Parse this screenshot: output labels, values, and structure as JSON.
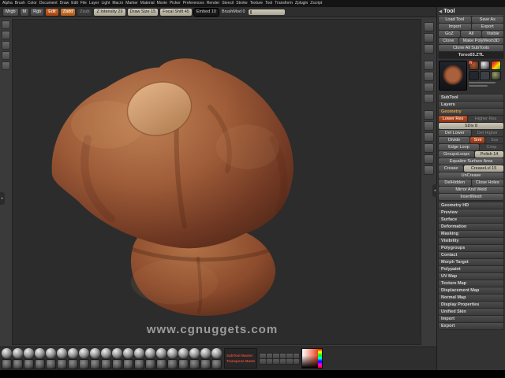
{
  "menu": {
    "items": [
      "Alpha",
      "Brush",
      "Color",
      "Document",
      "Draw",
      "Edit",
      "File",
      "Layer",
      "Light",
      "Macro",
      "Marker",
      "Material",
      "Movie",
      "Picker",
      "Preferences",
      "Render",
      "Stencil",
      "Stroke",
      "Texture",
      "Tool",
      "Transform",
      "Zplugin",
      "Zscript"
    ]
  },
  "shelf": {
    "mrgb": "Mrgb",
    "m": "M",
    "rgb": "Rgb",
    "edit": "Edit",
    "zadd": "Zadd",
    "zsub": "Zsub",
    "z_intensity": "Z Intensity 29",
    "draw_size": "Draw Size 15",
    "focal_shift": "Focal Shift 45",
    "embed": "Embed 10",
    "brush_mod": "BrushMod 0"
  },
  "canvas": {
    "watermark": "www.cgnuggets.com"
  },
  "tool": {
    "title": "Tool",
    "load_tool": "Load Tool",
    "save_as": "Save As",
    "import": "Import",
    "export": "Export",
    "goz": "GoZ",
    "all": "All",
    "visible": "Visible",
    "clone": "Clone",
    "make_polymesh3d": "Make PolyMesh3D",
    "clone_all_subtools": "Clone All SubTools",
    "active_tool_name": "Torso03.ZTL",
    "quick_pick_badge": "R",
    "sections": {
      "subtool": "SubTool",
      "layers": "Layers",
      "geometry": "Geometry"
    },
    "geometry": {
      "lower_res": "Lower Res",
      "higher_res": "Higher Res",
      "sdiv": "SDiv 8",
      "del_lower": "Del Lower",
      "del_higher": "Del Higher",
      "divide": "Divide",
      "smt": "Smt",
      "suv": "Suv",
      "edge_loop": "Edge Loop",
      "crisp": "Crisp",
      "groups_loops": "GroupsLoops",
      "polish": "Polish 14",
      "equalize": "Equalize Surface Area",
      "crease": "Crease",
      "crease_lvl": "CreaseLvl 15",
      "uncrease": "UnCrease",
      "del_hidden": "DelHidden",
      "close_holes": "Close Holes",
      "mirror_and_weld": "Mirror And Weld",
      "insert_mesh": "InsertMesh"
    },
    "collapsed_sections": [
      "Geometry HD",
      "Preview",
      "Surface",
      "Deformation",
      "Masking",
      "Visibility",
      "Polygroups",
      "Contact",
      "Morph Target",
      "Polypaint",
      "UV Map",
      "Texture Map",
      "Displacement Map",
      "Normal Map",
      "Display Properties",
      "Unified Skin",
      "Import",
      "Export"
    ]
  },
  "bottom": {
    "plugin_lines": [
      "SubTool Master",
      "Transpose Master"
    ],
    "material_count": 20,
    "thumb_count": 20,
    "mini_button_count": 12
  },
  "left_shelf": {
    "icon_count": 5
  },
  "right_shelf": {
    "group1": 3,
    "group2": 4,
    "group3": 6
  },
  "icons": {
    "tray_collapse": "◀",
    "divider_left": "▸",
    "divider_right": "◂"
  },
  "colors": {
    "accent_orange": "#c2552a",
    "clay": "#9e5c38",
    "canvas_bg": "#2c2c2c"
  }
}
